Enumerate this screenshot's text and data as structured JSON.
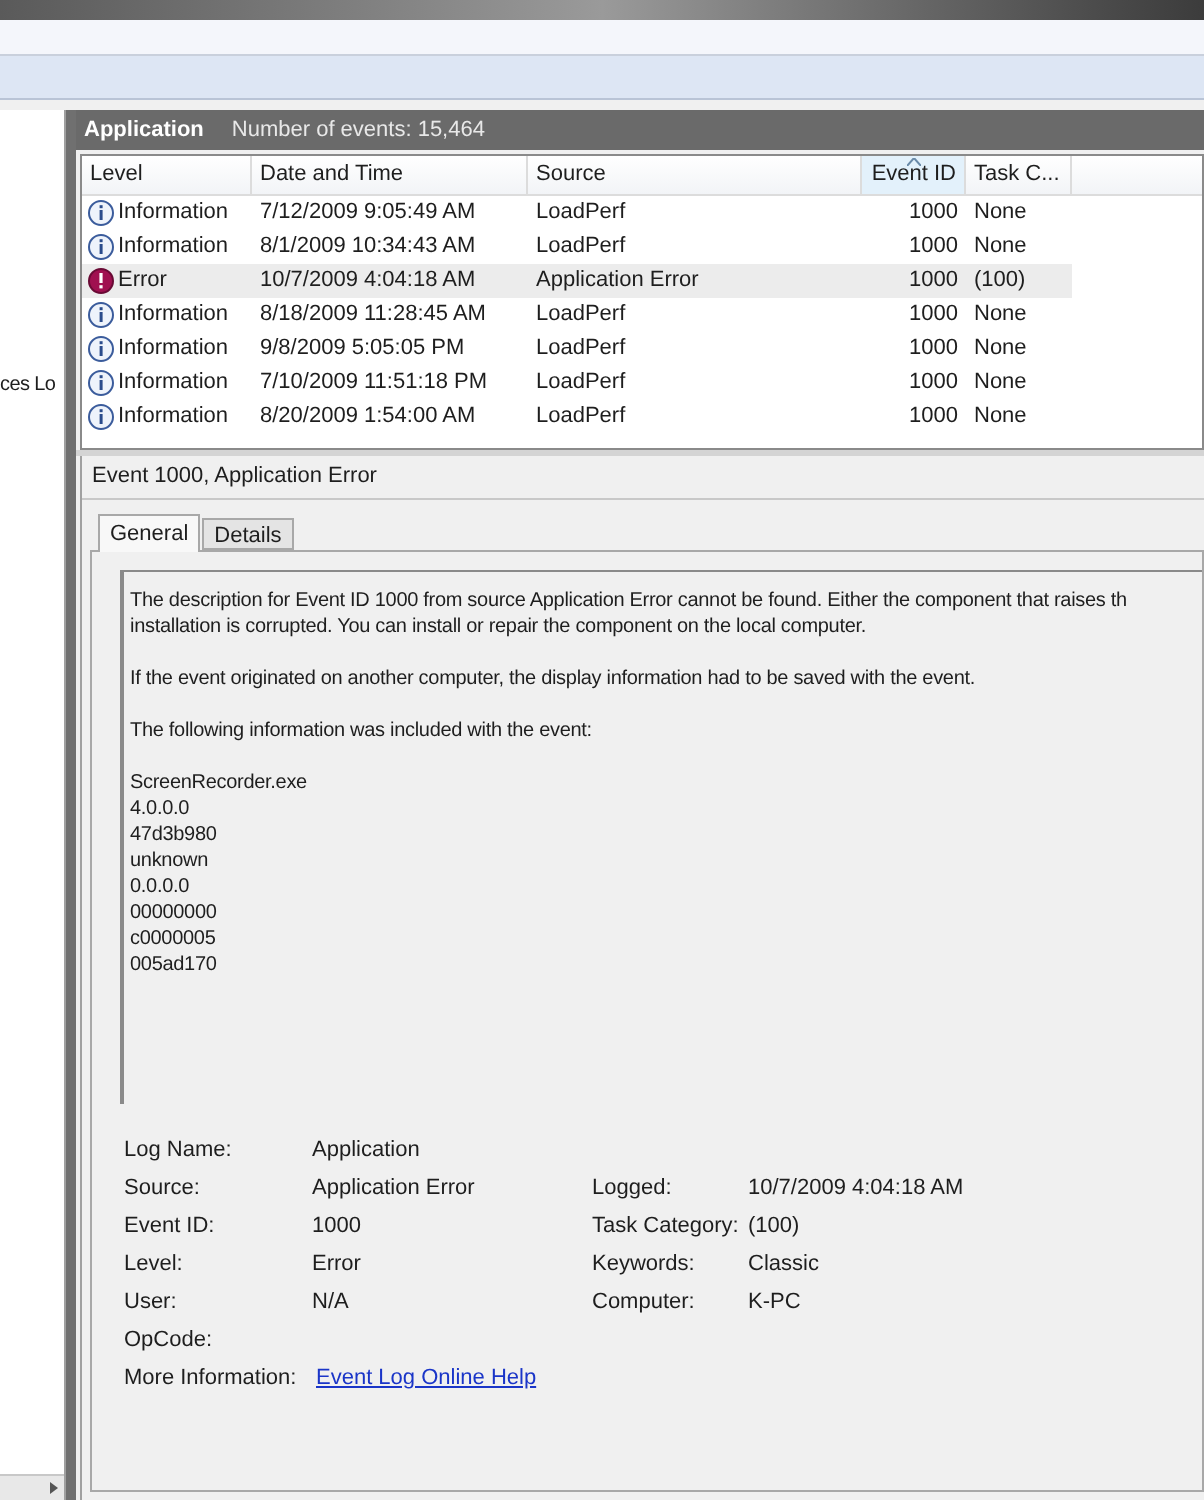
{
  "left_panel": {
    "item_text": "ces Lo"
  },
  "log_header": {
    "name": "Application",
    "count": "Number of events: 15,464"
  },
  "table": {
    "columns": [
      {
        "label": "Level",
        "sorted": false
      },
      {
        "label": "Date and Time",
        "sorted": false
      },
      {
        "label": "Source",
        "sorted": false
      },
      {
        "label": "Event ID",
        "sorted": true
      },
      {
        "label": "Task C...",
        "sorted": false
      }
    ],
    "rows": [
      {
        "kind": "information",
        "level": "Information",
        "date": "7/12/2009 9:05:49 AM",
        "source": "LoadPerf",
        "event_id": "1000",
        "task": "None",
        "selected": false
      },
      {
        "kind": "information",
        "level": "Information",
        "date": "8/1/2009 10:34:43 AM",
        "source": "LoadPerf",
        "event_id": "1000",
        "task": "None",
        "selected": false
      },
      {
        "kind": "error",
        "level": "Error",
        "date": "10/7/2009 4:04:18 AM",
        "source": "Application Error",
        "event_id": "1000",
        "task": "(100)",
        "selected": true
      },
      {
        "kind": "information",
        "level": "Information",
        "date": "8/18/2009 11:28:45 AM",
        "source": "LoadPerf",
        "event_id": "1000",
        "task": "None",
        "selected": false
      },
      {
        "kind": "information",
        "level": "Information",
        "date": "9/8/2009 5:05:05 PM",
        "source": "LoadPerf",
        "event_id": "1000",
        "task": "None",
        "selected": false
      },
      {
        "kind": "information",
        "level": "Information",
        "date": "7/10/2009 11:51:18 PM",
        "source": "LoadPerf",
        "event_id": "1000",
        "task": "None",
        "selected": false
      },
      {
        "kind": "information",
        "level": "Information",
        "date": "8/20/2009 1:54:00 AM",
        "source": "LoadPerf",
        "event_id": "1000",
        "task": "None",
        "selected": false
      }
    ]
  },
  "detail": {
    "title": "Event 1000, Application Error",
    "tabs": [
      {
        "label": "General",
        "selected": true
      },
      {
        "label": "Details",
        "selected": false
      }
    ],
    "description": [
      "The description for Event ID 1000 from source Application Error cannot be found. Either the component that raises th\ninstallation is corrupted. You can install or repair the component on the local computer.",
      "If the event originated on another computer, the display information had to be saved with the event.",
      "The following information was included with the event:",
      "ScreenRecorder.exe\n4.0.0.0\n47d3b980\nunknown\n0.0.0.0\n00000000\nc0000005\n005ad170"
    ],
    "properties": [
      [
        {
          "label": "Log Name:",
          "value": "Application"
        }
      ],
      [
        {
          "label": "Source:",
          "value": "Application Error"
        },
        {
          "label": "Logged:",
          "value": "10/7/2009 4:04:18 AM"
        }
      ],
      [
        {
          "label": "Event ID:",
          "value": "1000"
        },
        {
          "label": "Task Category:",
          "value": "(100)"
        }
      ],
      [
        {
          "label": "Level:",
          "value": "Error"
        },
        {
          "label": "Keywords:",
          "value": "Classic"
        }
      ],
      [
        {
          "label": "User:",
          "value": "N/A"
        },
        {
          "label": "Computer:",
          "value": "K-PC"
        }
      ],
      [
        {
          "label": "OpCode:"
        }
      ]
    ],
    "more_info": {
      "label": "More Information:",
      "link": "Event Log Online Help"
    }
  }
}
